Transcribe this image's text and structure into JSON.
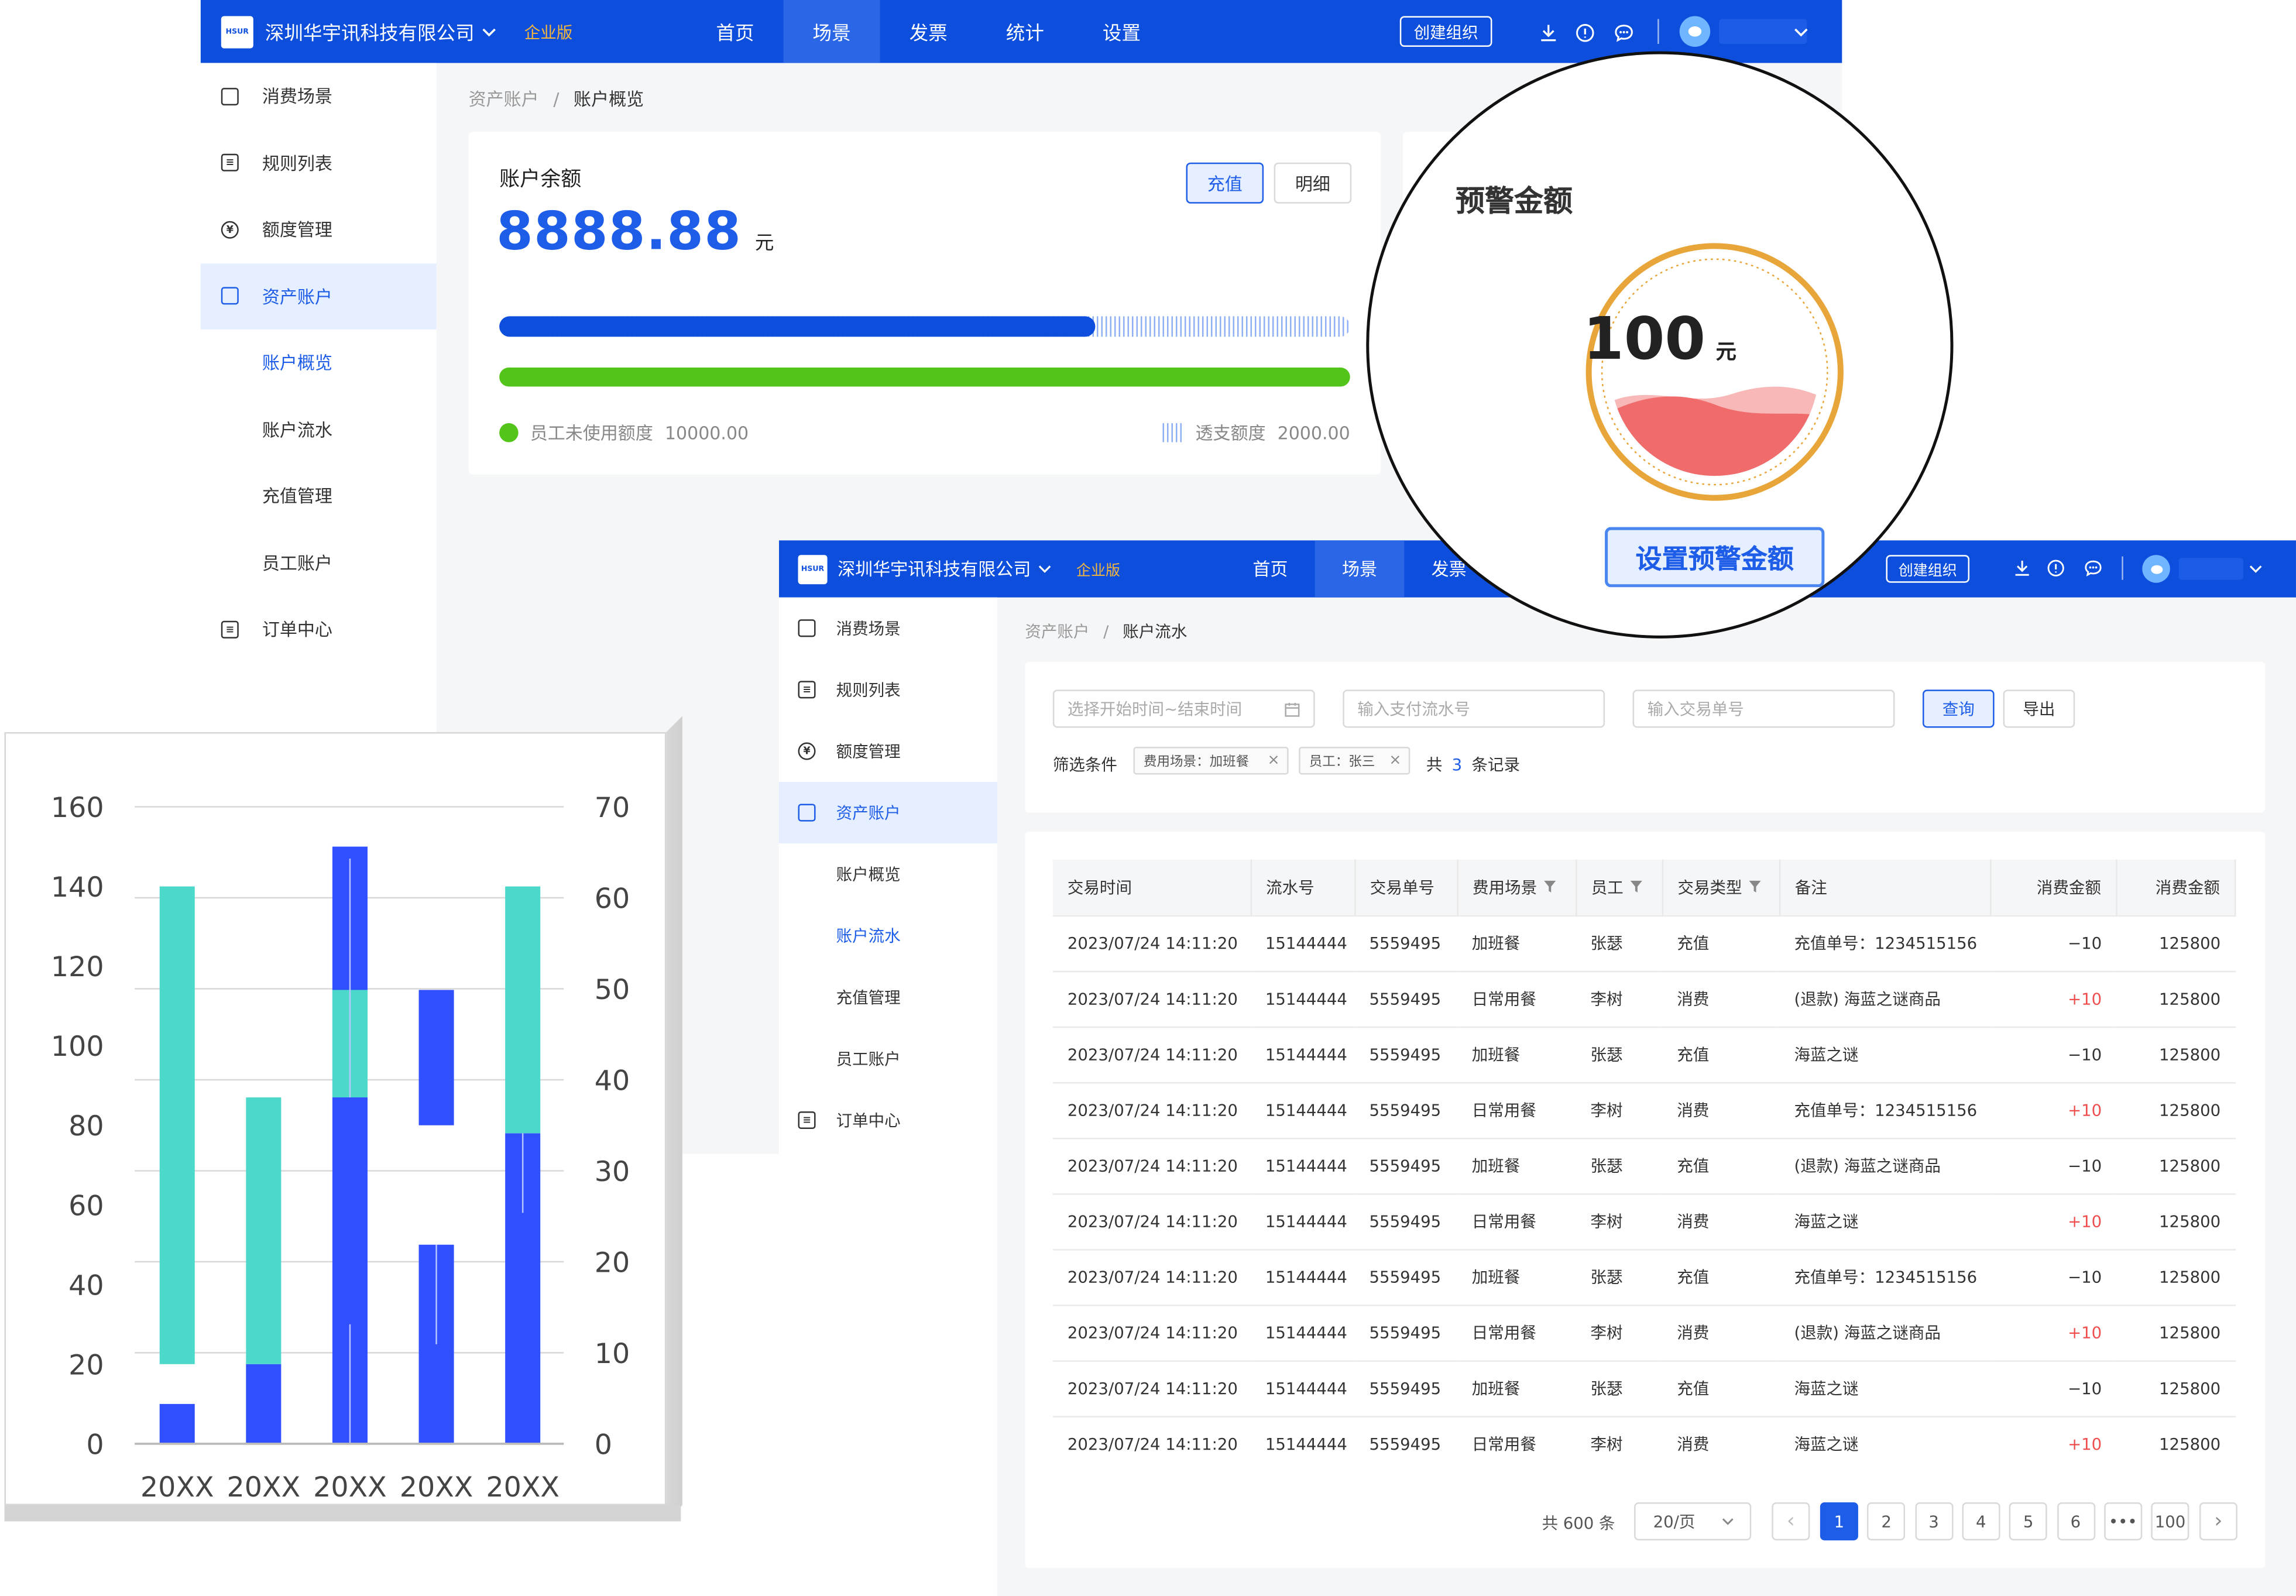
{
  "colors": {
    "brand": "#0d4fdc",
    "accent": "#1e5de8",
    "green": "#52c41a",
    "teal": "#4dd9c9",
    "chartBlue": "#3050ff",
    "gold": "#e8a63a",
    "red": "#f04e4e"
  },
  "back_window": {
    "header": {
      "company": "深圳华宇讯科技有限公司",
      "edition": "企业版",
      "nav": [
        "首页",
        "场景",
        "发票",
        "统计",
        "设置"
      ],
      "active_nav": 1,
      "create_org": "创建组织"
    },
    "sidebar": {
      "items": [
        {
          "label": "消费场景",
          "icon": "copy-icon",
          "type": "item"
        },
        {
          "label": "规则列表",
          "icon": "list-icon",
          "type": "item"
        },
        {
          "label": "额度管理",
          "icon": "yen-icon",
          "type": "item"
        },
        {
          "label": "资产账户",
          "icon": "wallet-icon",
          "type": "item",
          "active": true
        },
        {
          "label": "账户概览",
          "type": "sub",
          "active": true
        },
        {
          "label": "账户流水",
          "type": "sub"
        },
        {
          "label": "充值管理",
          "type": "sub"
        },
        {
          "label": "员工账户",
          "type": "sub"
        },
        {
          "label": "订单中心",
          "icon": "order-icon",
          "type": "item"
        }
      ]
    },
    "breadcrumb": {
      "parent": "资产账户",
      "sep": "/",
      "current": "账户概览"
    },
    "balance_card": {
      "title": "账户余额",
      "amount": "8888.88",
      "unit": "元",
      "recharge_label": "充值",
      "detail_label": "明细",
      "unused_label": "员工未使用额度",
      "unused_value": "10000.00",
      "overdraft_label": "透支额度",
      "overdraft_value": "2000.00",
      "used_fraction": 0.7
    },
    "alert_card": {
      "title": "预警金额",
      "value": "100",
      "unit": "元",
      "button": "设置预警金额"
    }
  },
  "front_window": {
    "header": {
      "company": "深圳华宇讯科技有限公司",
      "edition": "企业版",
      "nav": [
        "首页",
        "场景",
        "发票"
      ],
      "active_nav": 1,
      "create_org": "创建组织"
    },
    "sidebar": {
      "items": [
        {
          "label": "消费场景",
          "icon": "copy-icon",
          "type": "item"
        },
        {
          "label": "规则列表",
          "icon": "list-icon",
          "type": "item"
        },
        {
          "label": "额度管理",
          "icon": "yen-icon",
          "type": "item"
        },
        {
          "label": "资产账户",
          "icon": "wallet-icon",
          "type": "item",
          "active": true
        },
        {
          "label": "账户概览",
          "type": "sub"
        },
        {
          "label": "账户流水",
          "type": "sub",
          "active": true
        },
        {
          "label": "充值管理",
          "type": "sub"
        },
        {
          "label": "员工账户",
          "type": "sub"
        },
        {
          "label": "订单中心",
          "icon": "order-icon",
          "type": "item"
        }
      ]
    },
    "breadcrumb": {
      "parent": "资产账户",
      "sep": "/",
      "current": "账户流水"
    },
    "filters": {
      "date_placeholder": "选择开始时间~结束时间",
      "pay_placeholder": "输入支付流水号",
      "order_placeholder": "输入交易单号",
      "query_label": "查询",
      "export_label": "导出",
      "cond_label": "筛选条件",
      "tags": [
        "费用场景：加班餐",
        "员工：张三"
      ],
      "total_prefix": "共",
      "total_count": "3",
      "total_suffix": "条记录"
    },
    "table": {
      "columns": [
        "交易时间",
        "流水号",
        "交易单号",
        "费用场景",
        "员工",
        "交易类型",
        "备注",
        "消费金额",
        "消费金额"
      ],
      "filter_cols": [
        3,
        4,
        5
      ],
      "rows": [
        [
          "2023/07/24 14:11:20",
          "15144444",
          "5559495",
          "加班餐",
          "张瑟",
          "充值",
          "充值单号：1234515156",
          "−10",
          "125800"
        ],
        [
          "2023/07/24 14:11:20",
          "15144444",
          "5559495",
          "日常用餐",
          "李树",
          "消费",
          "(退款) 海蓝之谜商品",
          "+10",
          "125800"
        ],
        [
          "2023/07/24 14:11:20",
          "15144444",
          "5559495",
          "加班餐",
          "张瑟",
          "充值",
          "海蓝之谜",
          "−10",
          "125800"
        ],
        [
          "2023/07/24 14:11:20",
          "15144444",
          "5559495",
          "日常用餐",
          "李树",
          "消费",
          "充值单号：1234515156",
          "+10",
          "125800"
        ],
        [
          "2023/07/24 14:11:20",
          "15144444",
          "5559495",
          "加班餐",
          "张瑟",
          "充值",
          "(退款) 海蓝之谜商品",
          "−10",
          "125800"
        ],
        [
          "2023/07/24 14:11:20",
          "15144444",
          "5559495",
          "日常用餐",
          "李树",
          "消费",
          "海蓝之谜",
          "+10",
          "125800"
        ],
        [
          "2023/07/24 14:11:20",
          "15144444",
          "5559495",
          "加班餐",
          "张瑟",
          "充值",
          "充值单号：1234515156",
          "−10",
          "125800"
        ],
        [
          "2023/07/24 14:11:20",
          "15144444",
          "5559495",
          "日常用餐",
          "李树",
          "消费",
          "(退款) 海蓝之谜商品",
          "+10",
          "125800"
        ],
        [
          "2023/07/24 14:11:20",
          "15144444",
          "5559495",
          "加班餐",
          "张瑟",
          "充值",
          "海蓝之谜",
          "−10",
          "125800"
        ],
        [
          "2023/07/24 14:11:20",
          "15144444",
          "5559495",
          "日常用餐",
          "李树",
          "消费",
          "海蓝之谜",
          "+10",
          "125800"
        ]
      ]
    },
    "pagination": {
      "total": "共 600 条",
      "page_size": "20/页",
      "pages": [
        "1",
        "2",
        "3",
        "4",
        "5",
        "6",
        "•••",
        "100"
      ],
      "active_page": 0,
      "prev": "‹",
      "next": "›"
    }
  },
  "chart_data": {
    "type": "bar",
    "categories": [
      "20XX",
      "20XX",
      "20XX",
      "20XX",
      "20XX"
    ],
    "left_axis": {
      "ylim": [
        0,
        160
      ],
      "ticks": [
        "0",
        "20",
        "40",
        "60",
        "80",
        "100",
        "120",
        "140",
        "160"
      ]
    },
    "right_axis": {
      "ylim": [
        0,
        70
      ],
      "ticks": [
        "0",
        "10",
        "20",
        "30",
        "40",
        "50",
        "60",
        "70"
      ]
    },
    "series": [
      {
        "axis": "left",
        "values": [
          [
            0,
            10
          ],
          [
            0,
            20
          ],
          [
            0,
            150
          ],
          [
            0,
            50
          ],
          [
            0,
            140
          ]
        ],
        "label_note": "blue range bars"
      },
      {
        "axis": "right",
        "values": [
          [
            10,
            60
          ],
          [
            10,
            38
          ],
          [
            38,
            50
          ],
          [
            35,
            50
          ],
          [
            34,
            60
          ]
        ],
        "label_note": "teal / blue range bars"
      }
    ],
    "bars": [
      {
        "blue": [
          0,
          10
        ],
        "teal": [
          20,
          140
        ]
      },
      {
        "blue": [
          0,
          20
        ],
        "teal": [
          20,
          87
        ]
      },
      {
        "blue": [
          0,
          150
        ],
        "teal": [
          87,
          114
        ]
      },
      {
        "blue_low": [
          0,
          50
        ],
        "blue_high": [
          80,
          114
        ]
      },
      {
        "blue": [
          0,
          78
        ],
        "teal": [
          78,
          140
        ]
      }
    ]
  }
}
